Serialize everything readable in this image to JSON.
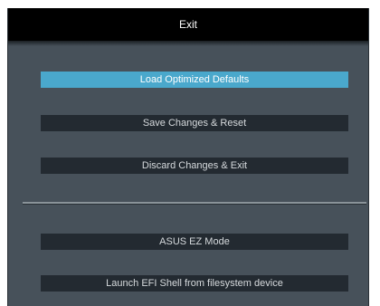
{
  "window": {
    "title": "Exit"
  },
  "menu": {
    "items": [
      {
        "label": "Load Optimized Defaults",
        "selected": true
      },
      {
        "label": "Save Changes & Reset",
        "selected": false
      },
      {
        "label": "Discard Changes & Exit",
        "selected": false
      },
      {
        "label": "ASUS EZ Mode",
        "selected": false
      },
      {
        "label": "Launch EFI Shell from filesystem device",
        "selected": false
      }
    ]
  },
  "colors": {
    "panel": "#47515a",
    "titlebar": "#000000",
    "button": "#232a31",
    "selected_button": "#4aa8cc"
  }
}
